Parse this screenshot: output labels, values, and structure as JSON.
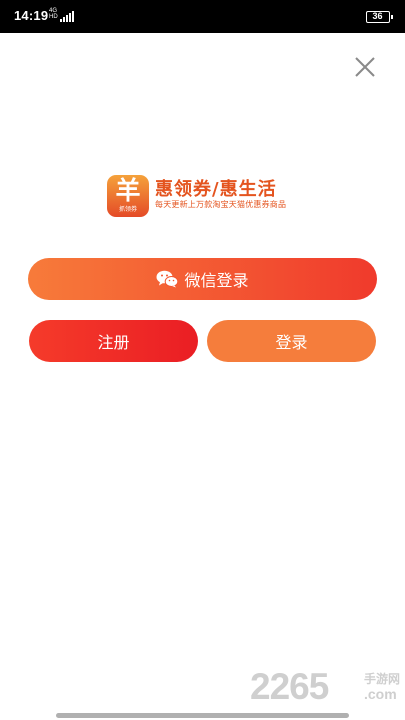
{
  "status_bar": {
    "time": "14:19",
    "network": "4G",
    "network_sub": "HD",
    "battery": "36"
  },
  "icons": {
    "close": "close-icon",
    "wechat": "wechat-icon",
    "signal": "signal-icon",
    "battery": "battery-icon"
  },
  "brand": {
    "logo_mark": "羊",
    "logo_sub": "抓领券",
    "title": "惠领券/惠生活",
    "slogan": "每天更新上万款淘宝天猫优惠券商品"
  },
  "buttons": {
    "wechat_login": "微信登录",
    "register": "注册",
    "login": "登录"
  },
  "watermark": {
    "number": "2265",
    "cn": "手游网",
    "com": ".com"
  },
  "colors": {
    "accent_orange": "#f57d3c",
    "accent_red": "#ea1e24",
    "brand_text": "#e4541f"
  }
}
